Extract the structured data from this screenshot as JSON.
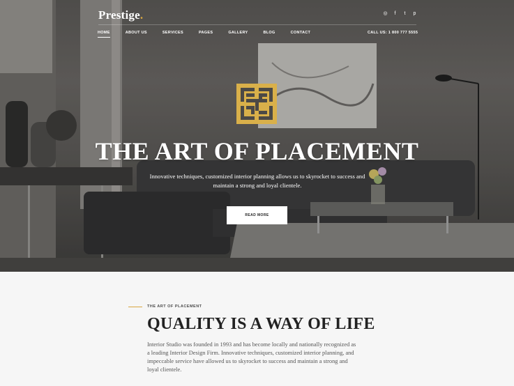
{
  "brand": {
    "name": "Prestige",
    "dot": ".",
    "accent_color": "#d9a640"
  },
  "social_icons": [
    {
      "icon": "instagram-icon",
      "glyph": "◎"
    },
    {
      "icon": "facebook-icon",
      "glyph": "f"
    },
    {
      "icon": "twitter-icon",
      "glyph": "t"
    },
    {
      "icon": "pinterest-icon",
      "glyph": "p"
    }
  ],
  "nav": {
    "items": [
      {
        "label": "HOME",
        "active": true
      },
      {
        "label": "ABOUT US"
      },
      {
        "label": "SERVICES"
      },
      {
        "label": "PAGES"
      },
      {
        "label": "GALLERY"
      },
      {
        "label": "BLOG"
      },
      {
        "label": "CONTACT"
      }
    ],
    "phone": "CALL US: 1 800 777 5555"
  },
  "hero": {
    "title": "THE ART OF PLACEMENT",
    "subtitle": "Innovative techniques, customized interior planning allows us to skyrocket to success and maintain a strong and loyal clientele.",
    "button_label": "READ MORE"
  },
  "intro": {
    "eyebrow": "THE ART OF PLACEMENT",
    "title": "QUALITY IS A WAY OF LIFE",
    "body": "Interior Studio was founded in 1993 and has become locally and nationally recognized as a leading Interior Design Firm. Innovative techniques, customized interior planning, and impeccable service have allowed us to skyrocket to success and maintain a strong and loyal clientele."
  }
}
